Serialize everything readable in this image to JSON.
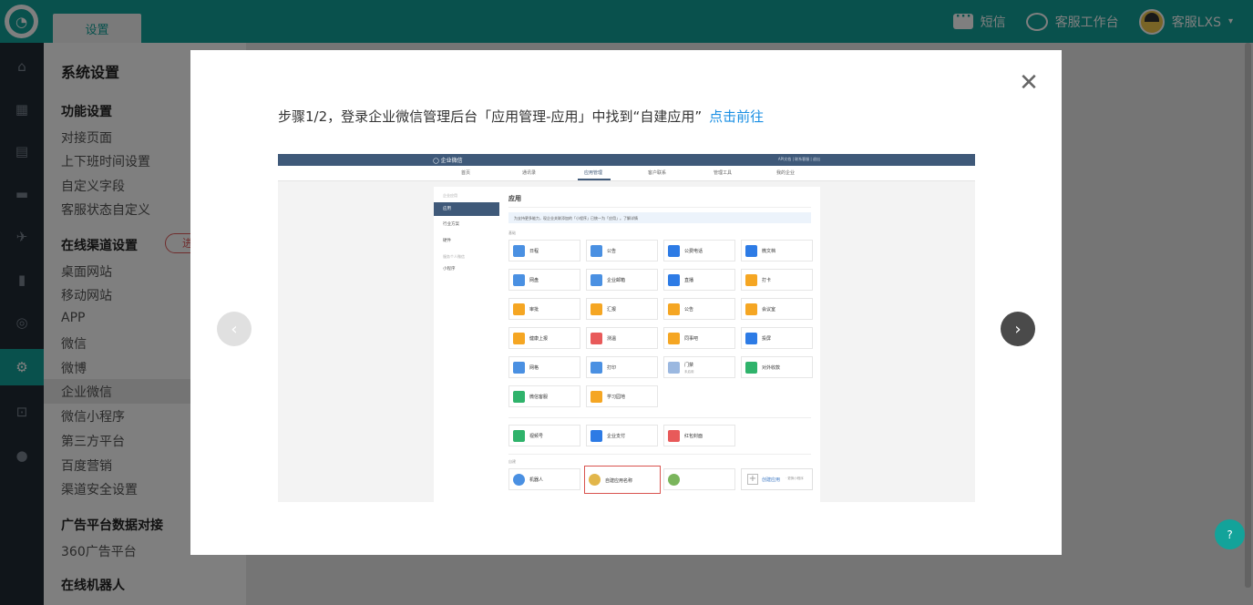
{
  "header": {
    "logo_glyph": "◔",
    "tab_label": "设置",
    "sms_label": "短信",
    "workbench_label": "客服工作台",
    "user_label": "客服LXS",
    "caret": "▾"
  },
  "rail_icons": [
    "⌂",
    "▦",
    "▤",
    "▬",
    "✈",
    "▮",
    "◎",
    "⚙",
    "⊡",
    "●"
  ],
  "menu": {
    "title": "系统设置",
    "group1": "功能设置",
    "group1_items": [
      "对接页面",
      "上下班时间设置",
      "自定义字段",
      "客服状态自定义"
    ],
    "group2": "在线渠道设置",
    "group2_pill": "进",
    "group2_items": [
      "桌面网站",
      "移动网站",
      "APP",
      "微信",
      "微博",
      "企业微信",
      "微信小程序",
      "第三方平台",
      "百度营销",
      "渠道安全设置"
    ],
    "group3": "广告平台数据对接",
    "group3_items": [
      "360广告平台"
    ],
    "group4": "在线机器人"
  },
  "modal": {
    "close_glyph": "✕",
    "step_text": "步骤1/2，登录企业微信管理后台「应用管理-应用」中找到“自建应用”",
    "step_link": "点击前往",
    "prev_glyph": "‹",
    "next_glyph": "›"
  },
  "screenshot": {
    "brand": "◯ 企业微信",
    "top_right": "API文档 | 联系客服 | 退出",
    "nav": [
      "首页",
      "通讯录",
      "应用管理",
      "客户联系",
      "管理工具",
      "我的企业"
    ],
    "side_sub1": "企业应用",
    "side_items": [
      "应用",
      "行业方案",
      "硬件"
    ],
    "side_sub2": "服务个人微信",
    "side_mini": "小程序",
    "main_title": "应用",
    "banner": "为支持更多能力，现企业关联添加的「小程序」已统一为「应用」。了解详情",
    "section_basic": "基础",
    "section_custom": "自建",
    "tiles": [
      [
        "日程",
        "公告",
        "公费电话",
        "微文档"
      ],
      [
        "网盘",
        "企业邮箱",
        "直播",
        "打卡"
      ],
      [
        "审批",
        "汇报",
        "公告",
        "会议室"
      ],
      [
        "健康上报",
        "测温",
        "同事吧",
        "投屏"
      ],
      [
        "网格",
        "打印",
        "门禁",
        "对外收款"
      ],
      [
        "微信客服",
        "学习园地"
      ]
    ],
    "tiles2": [
      "视频号",
      "企业支付",
      "红包封面"
    ],
    "custom": [
      "机器人",
      "自建应用名称",
      "",
      "创建应用"
    ],
    "door_sub": "未启用",
    "create_sub": "· 更换小程序"
  },
  "help_glyph": "?",
  "colors": {
    "brand": "#13a39a",
    "sidebar": "#202a35",
    "link": "#1a8fe3",
    "wecom_blue": "#3f5979",
    "highlight_red": "#d9534f"
  }
}
